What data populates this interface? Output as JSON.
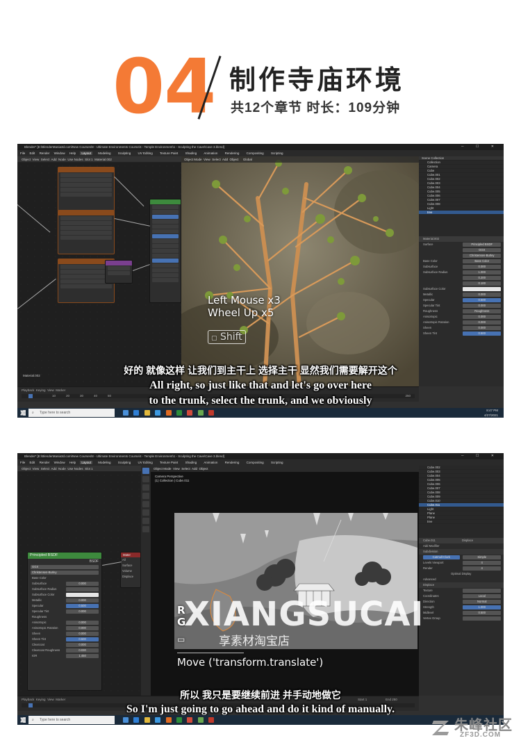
{
  "header": {
    "number": "04",
    "title": "制作寺庙环境",
    "subtitle": "共12个章节  时长：109分钟"
  },
  "shot1": {
    "window_title": "Blender* [E:\\BlenderMania3d.com\\New Courses\\8 - Ultimate Environments Course\\4 - Temple Environment\\1 - Sculpting the Cave\\Cave 3.blend]",
    "menu": [
      "File",
      "Edit",
      "Render",
      "Window",
      "Help"
    ],
    "tabs": [
      "Layout",
      "Modeling",
      "Sculpting",
      "UV Editing",
      "Texture Paint",
      "Shading",
      "Animation",
      "Rendering",
      "Compositing",
      "Scripting"
    ],
    "node_header": [
      "Object",
      "View",
      "Select",
      "Add",
      "Node",
      "Use Nodes",
      "Slot 1",
      "Material.002"
    ],
    "node_label": "Material.002",
    "viewport_header": [
      "Object Mode",
      "View",
      "Select",
      "Add",
      "Object",
      "Global"
    ],
    "screencast_keys": [
      "Left Mouse x3",
      "Wheel Up x5"
    ],
    "modifier_key": "Shift",
    "outliner_title": "Scene Collection",
    "outliner_items": [
      "Collection",
      "Camera",
      "Cube",
      "Cube.001",
      "Cube.002",
      "Cube.003",
      "Cube.004",
      "Cube.005",
      "Cube.006",
      "Cube.007",
      "Cube.008",
      "Light",
      "tree"
    ],
    "material_name": "Material.002",
    "surface_label": "Principled BSDF",
    "props": [
      {
        "label": "Surface",
        "value": "Principled BSDF"
      },
      {
        "label": "",
        "value": "GGX"
      },
      {
        "label": "",
        "value": "Christensen-Burley"
      },
      {
        "label": "Base Color",
        "value": "Base Color"
      },
      {
        "label": "Subsurface",
        "value": "0.000"
      },
      {
        "label": "Subsurface Radius",
        "value": "1.000"
      },
      {
        "label": "",
        "value": "0.200"
      },
      {
        "label": "",
        "value": "0.100"
      },
      {
        "label": "Subsurface Color",
        "value": ""
      },
      {
        "label": "Metallic",
        "value": "0.000"
      },
      {
        "label": "Specular",
        "value": "0.500"
      },
      {
        "label": "Specular Tint",
        "value": "0.000"
      },
      {
        "label": "Roughness",
        "value": "Roughness"
      },
      {
        "label": "Anisotropic",
        "value": "0.000"
      },
      {
        "label": "Anisotropic Rotation",
        "value": "0.000"
      },
      {
        "label": "Sheen",
        "value": "0.000"
      },
      {
        "label": "Sheen Tint",
        "value": "0.500"
      }
    ],
    "timeline": [
      "Playback",
      "Keying",
      "View",
      "Marker"
    ],
    "timeline_ticks": [
      "10",
      "20",
      "30",
      "40",
      "50"
    ],
    "end_frame": "250",
    "search_placeholder": "Type here to search",
    "clock_time": "8:47 PM",
    "clock_date": "4/27/2021",
    "subtitle_cn": "好的 就像这样 让我们到主干上 选择主干 显然我们需要解开这个",
    "subtitle_en": [
      "All right, so just like that and let's go over here",
      "to the trunk, select the trunk, and we obviously"
    ]
  },
  "shot2": {
    "window_title": "Blender* [E:\\BlenderMania3d.com\\New Courses\\8 - Ultimate Environments Course\\4 - Temple Environment\\1 - Sculpting the Cave\\Cave 3.blend]",
    "menu": [
      "File",
      "Edit",
      "Render",
      "Window",
      "Help"
    ],
    "tabs": [
      "Layout",
      "Modeling",
      "Sculpting",
      "UV Editing",
      "Texture Paint",
      "Shading",
      "Animation",
      "Rendering",
      "Compositing",
      "Scripting"
    ],
    "node_header": [
      "Object",
      "View",
      "Select",
      "Add",
      "Node",
      "Use Nodes",
      "Slot 1"
    ],
    "bsdf_title": "Principled BSDF",
    "bsdf_output": "BSDF",
    "bsdf_props": [
      {
        "label": "GGX",
        "value": ""
      },
      {
        "label": "Christensen-Burley",
        "value": ""
      },
      {
        "label": "Base Color",
        "value": ""
      },
      {
        "label": "Subsurface",
        "value": "0.000"
      },
      {
        "label": "Subsurface Radius",
        "value": ""
      },
      {
        "label": "Subsurface Color",
        "value": ""
      },
      {
        "label": "Metallic",
        "value": "0.000"
      },
      {
        "label": "Specular",
        "value": "0.500"
      },
      {
        "label": "Specular Tint",
        "value": "0.000"
      },
      {
        "label": "Roughness",
        "value": ""
      },
      {
        "label": "Anisotropic",
        "value": "0.000"
      },
      {
        "label": "Anisotropic Rotation",
        "value": "0.000"
      },
      {
        "label": "Sheen",
        "value": "0.000"
      },
      {
        "label": "Sheen Tint",
        "value": "0.500"
      },
      {
        "label": "Clearcoat",
        "value": "0.000"
      },
      {
        "label": "Clearcoat Roughness",
        "value": "0.030"
      },
      {
        "label": "IOR",
        "value": "1.450"
      }
    ],
    "output_title": "Mater",
    "output_sockets": [
      "All",
      "Surface",
      "Volume",
      "Displace"
    ],
    "viewport_header": [
      "Object Mode",
      "View",
      "Select",
      "Add",
      "Object"
    ],
    "camera_info": [
      "Camera Perspective",
      "(1) Collection | Cube.011"
    ],
    "screencast_keys": [
      "R",
      "G"
    ],
    "operator": "Move ('transform.translate')",
    "watermark": "XIANGSUCAI",
    "watermark_cn": "享素材淘宝店",
    "outliner_items": [
      "Cube.002",
      "Cube.003",
      "Cube.004",
      "Cube.005",
      "Cube.006",
      "Cube.007",
      "Cube.008",
      "Cube.009",
      "Cube.010",
      "Cube.011",
      "Light",
      "Plane",
      "Plane",
      "tree"
    ],
    "object_name": "Cube.011",
    "modifier_stack": "Displace",
    "add_modifier": "Add Modifier",
    "modifiers": [
      {
        "label": "Subdivision",
        "value": ""
      },
      {
        "label": "Catmull-Clark",
        "value": "Simple"
      },
      {
        "label": "Levels Viewport",
        "value": "4"
      },
      {
        "label": "Render",
        "value": "4"
      },
      {
        "label": "Optimal Display",
        "value": ""
      },
      {
        "label": "Advanced",
        "value": ""
      },
      {
        "label": "Displace",
        "value": ""
      },
      {
        "label": "Texture",
        "value": ""
      },
      {
        "label": "Coordinates",
        "value": "Local"
      },
      {
        "label": "Direction",
        "value": "Normal"
      },
      {
        "label": "Strength",
        "value": "1.000"
      },
      {
        "label": "Midlevel",
        "value": "0.500"
      },
      {
        "label": "Vertex Group",
        "value": ""
      }
    ],
    "timeline": [
      "Playback",
      "Keying",
      "View",
      "Marker"
    ],
    "start_label": "Start",
    "start_frame": "1",
    "end_label": "End",
    "end_frame": "250",
    "search_placeholder": "Type here to search",
    "subtitle_cn": "所以 我只是要继续前进 并手动地做它",
    "subtitle_en": "So I'm just going to go ahead and do it kind of manually."
  },
  "corner_logo": {
    "cn": "朱峰社区",
    "en": "ZF3D.COM"
  },
  "colors": {
    "accent": "#f47a35",
    "blender_blue": "#4772b3",
    "node_orange": "#8a4a1c",
    "bsdf_green": "#3d8a3d",
    "output_red": "#8a2a2a"
  }
}
